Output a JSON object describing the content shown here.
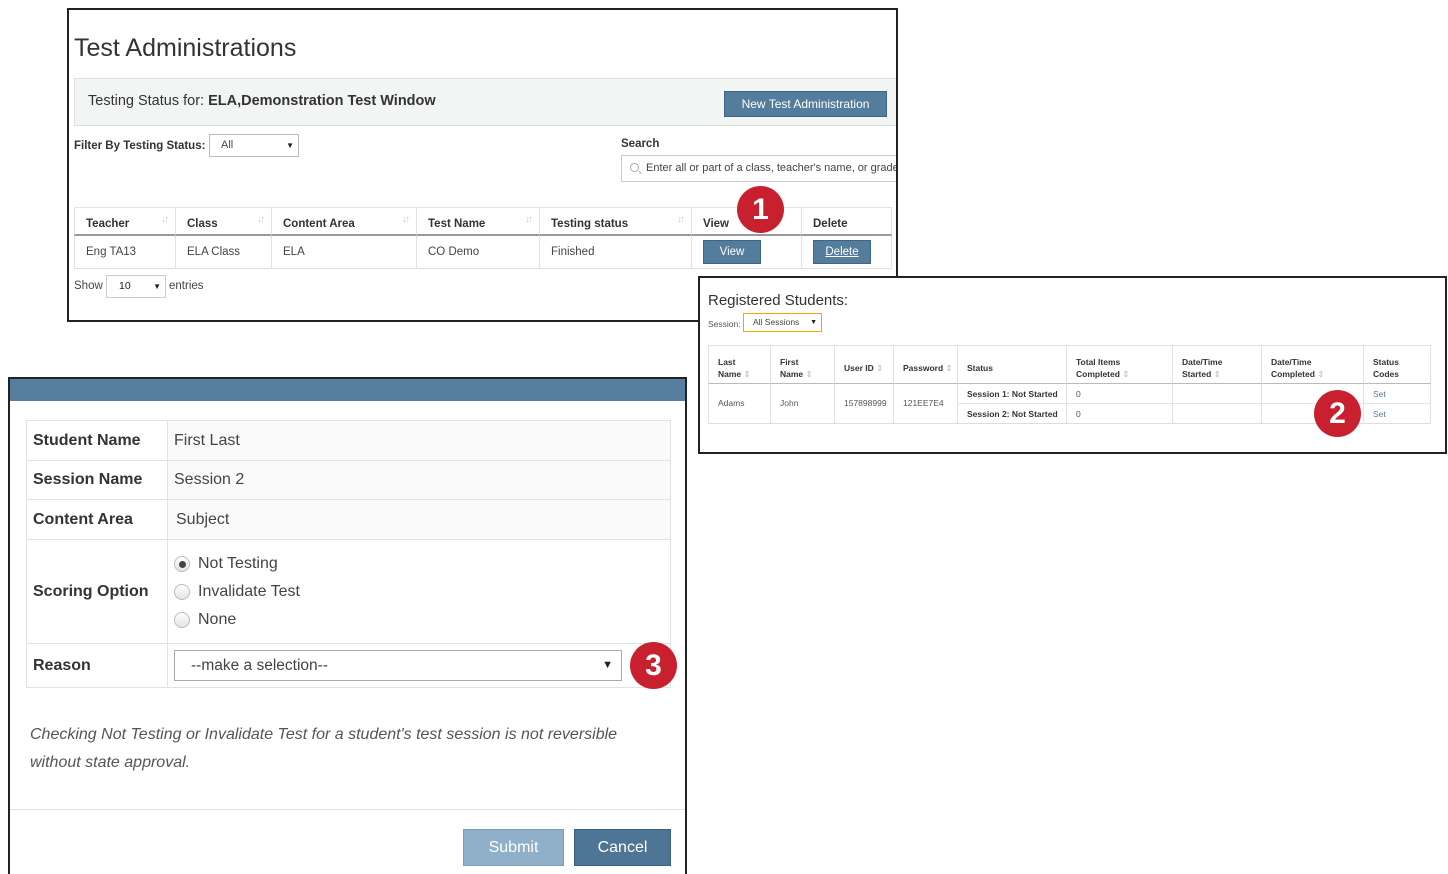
{
  "admin": {
    "title": "Test Administrations",
    "status_label": "Testing Status for: ",
    "status_value": "ELA,Demonstration Test Window",
    "new_button": "New Test Administration",
    "filter_label": "Filter By Testing Status:",
    "filter_value": "All",
    "search_label": "Search",
    "search_placeholder": "Enter all or part of a class, teacher's name, or grade",
    "columns": [
      "Teacher",
      "Class",
      "Content Area",
      "Test Name",
      "Testing status",
      "View",
      "Delete"
    ],
    "rows": [
      {
        "teacher": "Eng TA13",
        "class": "ELA Class",
        "content_area": "ELA",
        "test_name": "CO Demo",
        "testing_status": "Finished",
        "view_label": "View",
        "delete_label": "Delete"
      }
    ],
    "show_label": "Show",
    "show_value": "10",
    "entries_label": "entries"
  },
  "badges": {
    "one": "1",
    "two": "2",
    "three": "3"
  },
  "students": {
    "title": "Registered Students:",
    "session_label": "Session:",
    "session_value": "All Sessions",
    "columns": [
      {
        "l1": "Last",
        "l2": "Name"
      },
      {
        "l1": "First",
        "l2": "Name"
      },
      {
        "l1": "User ID",
        "l2": ""
      },
      {
        "l1": "Password",
        "l2": ""
      },
      {
        "l1": "Status",
        "l2": ""
      },
      {
        "l1": "Total Items",
        "l2": "Completed"
      },
      {
        "l1": "Date/Time",
        "l2": "Started"
      },
      {
        "l1": "Date/Time",
        "l2": "Completed"
      },
      {
        "l1": "Status",
        "l2": "Codes"
      }
    ],
    "row": {
      "last_name": "Adams",
      "first_name": "John",
      "user_id": "157898999",
      "password": "121EE7E4",
      "status_1": "Session 1: Not Started",
      "status_2": "Session 2: Not Started",
      "items_1": "0",
      "items_2": "0",
      "set_1": "Set",
      "set_2": "Set"
    }
  },
  "modal": {
    "student_name_label": "Student Name",
    "student_name_value": "First Last",
    "session_name_label": "Session Name",
    "session_name_value": "Session 2",
    "content_area_label": "Content Area",
    "content_area_value": "Subject",
    "scoring_option_label": "Scoring Option",
    "options": [
      "Not Testing",
      "Invalidate Test",
      "None"
    ],
    "selected_option": "Not Testing",
    "reason_label": "Reason",
    "reason_placeholder": "--make a selection--",
    "note": "Checking Not Testing or Invalidate Test for a student's test session is not reversible without state approval.",
    "submit_label": "Submit",
    "cancel_label": "Cancel"
  },
  "colors": {
    "button_blue": "#547c9c",
    "badge_red": "#c8202f",
    "modal_header": "#587e9f",
    "session_select_border": "#f0a500"
  }
}
